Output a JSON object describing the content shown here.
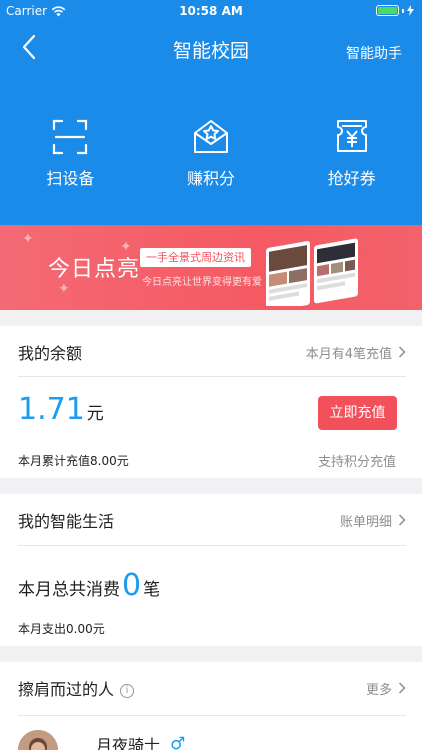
{
  "status_bar": {
    "carrier": "Carrier",
    "time": "10:58 AM"
  },
  "nav": {
    "title": "智能校园",
    "assistant": "智能助手"
  },
  "actions": [
    {
      "label": "扫设备",
      "icon": "scan-icon"
    },
    {
      "label": "赚积分",
      "icon": "points-star-icon"
    },
    {
      "label": "抢好券",
      "icon": "coupon-icon"
    }
  ],
  "banner": {
    "title": "今日点亮",
    "tag": "一手全景式周边资讯",
    "subtitle": "今日点亮让世界变得更有爱"
  },
  "balance": {
    "title": "我的余额",
    "link": "本月有4笔充值",
    "amount": "1.71",
    "unit": "元",
    "recharge_label": "立即充值",
    "monthly_total": "本月累计充值8.00元",
    "points_support": "支持积分充值"
  },
  "smart_life": {
    "title": "我的智能生活",
    "link": "账单明细",
    "consume_prefix": "本月总共消费",
    "consume_count": "0",
    "consume_suffix": "笔",
    "monthly_spend": "本月支出0.00元"
  },
  "passers": {
    "title": "擦肩而过的人",
    "info_symbol": "i",
    "link": "更多",
    "user_name": "月夜骑士",
    "gender_symbol": "♂"
  },
  "colors": {
    "primary": "#1a8be8",
    "accent": "#f2515b",
    "number": "#1a9cf0"
  }
}
